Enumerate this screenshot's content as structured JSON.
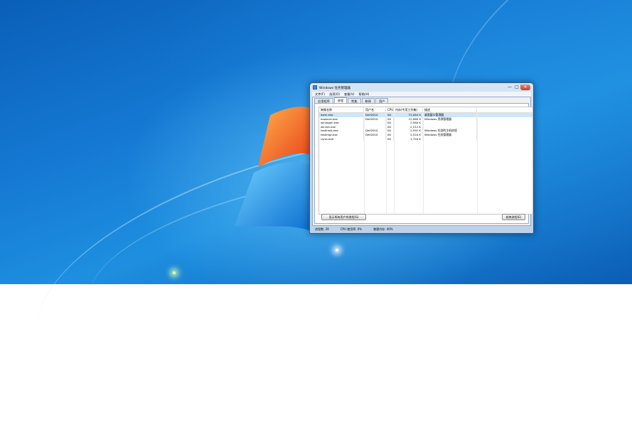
{
  "taskmanager": {
    "title": "Windows 任务管理器",
    "window_controls": {
      "minimize": "—",
      "maximize": "□",
      "close": "✕"
    },
    "menu": [
      "文件(F)",
      "选项(O)",
      "查看(V)",
      "帮助(H)"
    ],
    "tabs": [
      "应用程序",
      "进程",
      "性能",
      "联网",
      "用户"
    ],
    "active_tab": "进程",
    "columns": [
      "映像名称",
      "用户名",
      "CPU",
      "内存(专用工作集)",
      "描述"
    ],
    "rows": [
      [
        "dwm.exe",
        "Dell2010",
        "00",
        "31,064 K",
        "桌面窗口管理器"
      ],
      [
        "explorer.exe",
        "Dell2010",
        "00",
        "12,060 K",
        "Windows 资源管理器"
      ],
      [
        "winlogon.exe",
        "",
        "00",
        "2,580 K",
        ""
      ],
      [
        "wininit.exe",
        "",
        "00",
        "2,512 K",
        ""
      ],
      [
        "taskhost.exe",
        "Dell2010",
        "00",
        "2,592 K",
        "Windows 任务的主机进程"
      ],
      [
        "taskmgr.exe",
        "Dell2010",
        "00",
        "2,520 K",
        "Windows 任务管理器"
      ],
      [
        "csrss.exe",
        "",
        "00",
        "1,720 K",
        ""
      ]
    ],
    "selected_row": 0,
    "buttons": {
      "show_all": "显示所有用户的进程(S)",
      "end_process": "结束进程(E)"
    },
    "status": {
      "processes": "进程数: 29",
      "cpu": "CPU 使用率: 0%",
      "memory": "物理内存: 40%"
    }
  }
}
